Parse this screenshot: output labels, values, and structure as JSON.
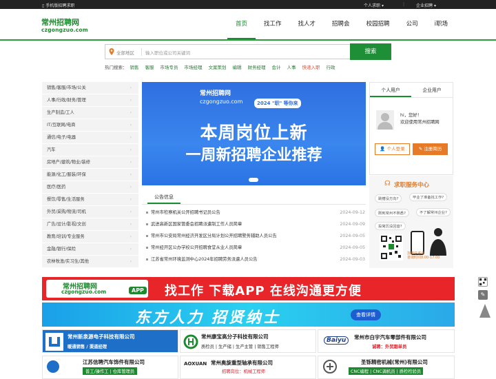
{
  "topbar": {
    "mobile": "手机版招聘求职",
    "personal": "个人求职",
    "company": "企业招聘",
    "sep": "|"
  },
  "logo": {
    "cn": "常州招聘网",
    "en": "czgongzuo.com"
  },
  "nav": [
    "首页",
    "找工作",
    "找人才",
    "招聘会",
    "校园招聘",
    "公司",
    "i职场"
  ],
  "search": {
    "area": "全部地区",
    "placeholder": "输入职位或公司关键词",
    "button": "搜索"
  },
  "hot": {
    "label": "热门搜索：",
    "items": [
      "销售",
      "客服",
      "市场专员",
      "市场经理",
      "文案策划",
      "编辑",
      "财务经理",
      "会计",
      "人事"
    ],
    "red": "快递入职",
    "last": "行政"
  },
  "categories": [
    "销售/客服/市场/公关",
    "人事/行政/财务/管理",
    "生产制造/工人",
    "IT/互联网/电商",
    "通信/电子/电器",
    "汽车",
    "房地产/建筑/物业/装修",
    "能源/化工/服装/环保",
    "医疗/医药",
    "餐饮/零售/生活服务",
    "外贸/采购/物流/司机",
    "广告/设计/影视/文创",
    "教育/培训/专业服务",
    "金融/银行/保险",
    "农林牧渔/实习生/其他"
  ],
  "banner": {
    "logo_cn": "常州招聘网",
    "logo_en": "czgongzuo.com",
    "tag": "2024 \"职\" 等你来",
    "line1": "本周岗位上新",
    "line2": "一周新招聘企业推荐"
  },
  "notice": {
    "tab": "公告信息",
    "items": [
      {
        "title": "常州市检察机关公开招聘书记员公告",
        "date": "2024-09-12"
      },
      {
        "title": "武进高新区国家管委会招聘派遣制工作人员简章",
        "date": "2024-09-09"
      },
      {
        "title": "常州市公安局常州经济开发区分局计划公开招聘警务辅助人员公告",
        "date": "2024-09-05"
      },
      {
        "title": "常州经开区公办学校公开招聘食堂从业人员简章",
        "date": "2024-09-05"
      },
      {
        "title": "江苏省常州环境监测中心2024年招聘劳务派遣人员公告",
        "date": "2024-09-03"
      }
    ]
  },
  "user": {
    "tab_personal": "个人用户",
    "tab_company": "企业用户",
    "hi": "hi，您好！",
    "welcome": "欢迎使用常州招聘网",
    "login": "个人登录",
    "register": "注册简历"
  },
  "service": {
    "title": "求职服务中心",
    "q1": "跳槽没方向?",
    "q2": "毕业了准备找工作?",
    "q3": "刚到常州不熟悉?",
    "q4": "不了解常州企业?",
    "q5": "投简历没回音?",
    "tel": "加微信咨询",
    "hours": "咨询时间8:00-17:00"
  },
  "app_banner": {
    "cn": "常州招聘网",
    "en": "czgongzuo.com",
    "tag": "APP",
    "msg": "找工作 下载APP 在线沟通更方便"
  },
  "df_banner": {
    "msg": "东方人力  招贤纳士",
    "btn": "查看详情"
  },
  "companies": [
    {
      "name": "常州新泉源电子科技有限公司",
      "badge": "诚聘",
      "jobs": "暖通销售 / 渠道经理"
    },
    {
      "name": "常州康宝高分子科技有限公司",
      "badge": "诚聘",
      "jobs": "质检员 | 生产储 | 生产主管 | 销售工程师"
    },
    {
      "name": "常州市白宇汽车零部件有限公司",
      "badge": "",
      "jobs": "诚聘：外贸跟单员"
    },
    {
      "name": "江苏信聘汽车饰件有限公司",
      "badge": "",
      "jobs": "普工/操作工 | 仓库管理员"
    },
    {
      "name": "常州奥旋重型轴承有限公司",
      "badge": "",
      "jobs": "招聘岗位：机械工程师"
    },
    {
      "name": "圣铄精密机械(常州)有限公司",
      "badge": "",
      "jobs": "CNC编程 | CNC调机员 | 质检检验员"
    }
  ],
  "colors": {
    "brand": "#1c8a2e",
    "orange": "#e67a26",
    "red": "#e8262a"
  }
}
